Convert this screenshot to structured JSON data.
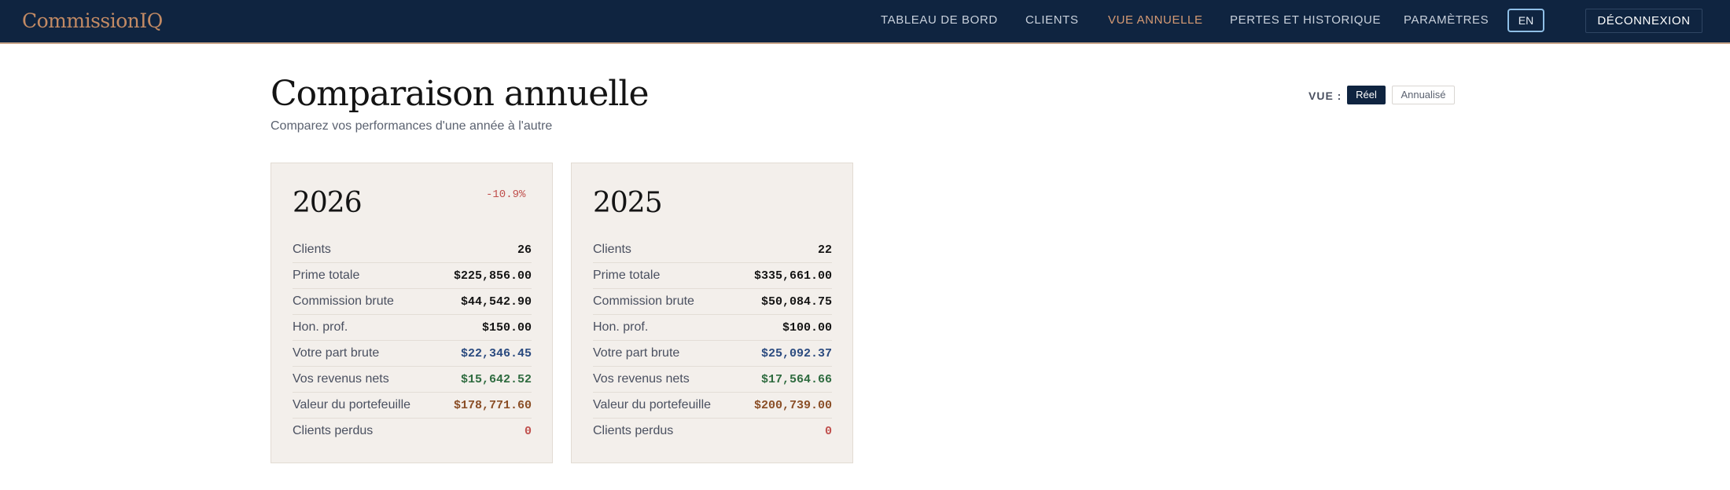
{
  "app": {
    "brand": "CommissionIQ"
  },
  "nav": {
    "items": [
      {
        "label": "TABLEAU DE BORD",
        "active": false
      },
      {
        "label": "CLIENTS",
        "active": false
      },
      {
        "label": "VUE ANNUELLE",
        "active": true
      },
      {
        "label": "PERTES ET HISTORIQUE",
        "active": false
      },
      {
        "label": "PARAMÈTRES",
        "active": false
      }
    ],
    "lang_label": "EN",
    "logout_label": "DÉCONNEXION"
  },
  "header": {
    "title": "Comparaison annuelle",
    "subtitle": "Comparez vos performances d'une année à l'autre",
    "view_label": "VUE :",
    "view_options": [
      {
        "label": "Réel",
        "selected": true
      },
      {
        "label": "Annualisé",
        "selected": false
      }
    ]
  },
  "colors": {
    "navy": "#0f2440",
    "accent": "#d59a74",
    "negative": "#c0504d",
    "blue_value": "#2a4a7f",
    "green_value": "#2e6b3f",
    "brown_value": "#8a4e26",
    "red_value": "#c0504d"
  },
  "cards": [
    {
      "year": "2026",
      "change": "-10.9%",
      "rows": [
        {
          "label": "Clients",
          "value": "26",
          "tone": "default"
        },
        {
          "label": "Prime totale",
          "value": "$225,856.00",
          "tone": "default"
        },
        {
          "label": "Commission brute",
          "value": "$44,542.90",
          "tone": "default"
        },
        {
          "label": "Hon. prof.",
          "value": "$150.00",
          "tone": "default"
        },
        {
          "label": "Votre part brute",
          "value": "$22,346.45",
          "tone": "blue"
        },
        {
          "label": "Vos revenus nets",
          "value": "$15,642.52",
          "tone": "green"
        },
        {
          "label": "Valeur du portefeuille",
          "value": "$178,771.60",
          "tone": "brown"
        },
        {
          "label": "Clients perdus",
          "value": "0",
          "tone": "red"
        }
      ]
    },
    {
      "year": "2025",
      "change": "",
      "rows": [
        {
          "label": "Clients",
          "value": "22",
          "tone": "default"
        },
        {
          "label": "Prime totale",
          "value": "$335,661.00",
          "tone": "default"
        },
        {
          "label": "Commission brute",
          "value": "$50,084.75",
          "tone": "default"
        },
        {
          "label": "Hon. prof.",
          "value": "$100.00",
          "tone": "default"
        },
        {
          "label": "Votre part brute",
          "value": "$25,092.37",
          "tone": "blue"
        },
        {
          "label": "Vos revenus nets",
          "value": "$17,564.66",
          "tone": "green"
        },
        {
          "label": "Valeur du portefeuille",
          "value": "$200,739.00",
          "tone": "brown"
        },
        {
          "label": "Clients perdus",
          "value": "0",
          "tone": "red"
        }
      ]
    }
  ]
}
